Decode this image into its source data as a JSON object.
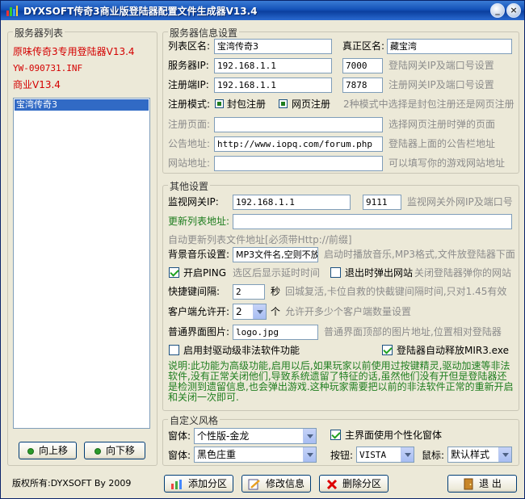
{
  "window": {
    "title": "DYXSOFT传奇3商业版登陆器配置文件生成器V13.4",
    "minimize_glyph": "_",
    "close_glyph": "×"
  },
  "server_list": {
    "group_title": "服务器列表",
    "line1": "原味传奇3专用登陆器V13.4",
    "line2": "YW-090731.INF",
    "line3": "商业V13.4",
    "items": [
      "宝湾传奇3"
    ],
    "move_up_label": "向上移",
    "move_down_label": "向下移"
  },
  "server_info": {
    "group_title": "服务器信息设置",
    "list_name_label": "列表区名:",
    "list_name_value": "宝湾传奇3",
    "real_name_label": "真正区名:",
    "real_name_value": "藏宝湾",
    "server_ip_label": "服务器IP:",
    "server_ip_value": "192.168.1.1",
    "server_port_value": "7000",
    "server_ip_hint": "登陆网关IP及端口号设置",
    "reg_ip_label": "注册端IP:",
    "reg_ip_value": "192.168.1.1",
    "reg_port_value": "7878",
    "reg_ip_hint": "注册网关IP及端口号设置",
    "reg_mode_label": "注册模式:",
    "reg_mode_opt1": "封包注册",
    "reg_mode_opt2": "网页注册",
    "reg_mode_hint": "2种模式中选择是封包注册还是网页注册",
    "reg_page_label": "注册页面:",
    "reg_page_value": "",
    "reg_page_hint": "选择网页注册时弹的页面",
    "notice_label": "公告地址:",
    "notice_value": "http://www.iopq.com/forum.php",
    "notice_hint": "登陆器上面的公告栏地址",
    "website_label": "网站地址:",
    "website_value": "",
    "website_hint": "可以填写你的游戏网站地址"
  },
  "other": {
    "group_title": "其他设置",
    "monitor_label": "监视网关IP:",
    "monitor_ip_value": "192.168.1.1",
    "monitor_port_value": "9111",
    "monitor_hint": "监视网关外网IP及端口号",
    "update_list_label": "更新列表地址:",
    "update_list_value": "",
    "update_list_hint": "自动更新列表文件地址[必须带Http://前缀]",
    "bgm_label": "背景音乐设置:",
    "bgm_value": "MP3文件名,空则不放",
    "bgm_hint": "启动时播放音乐,MP3格式,文件放登陆器下面",
    "ping_label": "开启PING",
    "ping_hint": "选区后显示延时时间",
    "exit_popup_label": "退出时弹出网站",
    "exit_popup_hint": "关闭登陆器弹你的网站",
    "hotkey_label": "快捷键间隔:",
    "hotkey_value": "2",
    "hotkey_unit": "秒",
    "hotkey_hint": "回城复活,卡位自救的快截键间隔时间,只对1.45有效",
    "clients_label": "客户端允许开:",
    "clients_value": "2",
    "clients_unit": "个",
    "clients_hint": "允许开多少个客户端数量设置",
    "ui_image_label": "普通界面图片:",
    "ui_image_value": "logo.jpg",
    "ui_image_hint": "普通界面顶部的图片地址,位置相对登陆器",
    "driver_label": "启用封驱动级非法软件功能",
    "auto_release_label": "登陆器自动释放MIR3.exe",
    "description": "说明:此功能为高级功能,启用以后,如果玩家以前使用过按键精灵,驱动加速等非法软件,没有正常关闭他们,导致系统遗留了特征的话,虽然他们没有开但是登陆器还是检测到遗留信息,也会弹出游戏.这种玩家需要把以前的非法软件正常的重新开启和关闭一次即可."
  },
  "style": {
    "group_title": "自定义风格",
    "window_label": "窗体:",
    "window_value1": "个性版-金龙",
    "window_value2": "黑色庄重",
    "personal_label": "主界面使用个性化窗体",
    "button_label": "按钮:",
    "button_value": "VISTA",
    "cursor_label": "鼠标:",
    "cursor_value": "默认样式"
  },
  "footer": {
    "copyright": "版权所有:DYXSOFT By 2009",
    "add_label": "添加分区",
    "edit_label": "修改信息",
    "delete_label": "删除分区",
    "exit_label": "退  出"
  },
  "colors": {
    "titlebar": "#1452b8",
    "red_text": "#d40000",
    "green_text": "#1e7d1e",
    "selection": "#316ac5",
    "window_bg": "#ece9d8"
  }
}
